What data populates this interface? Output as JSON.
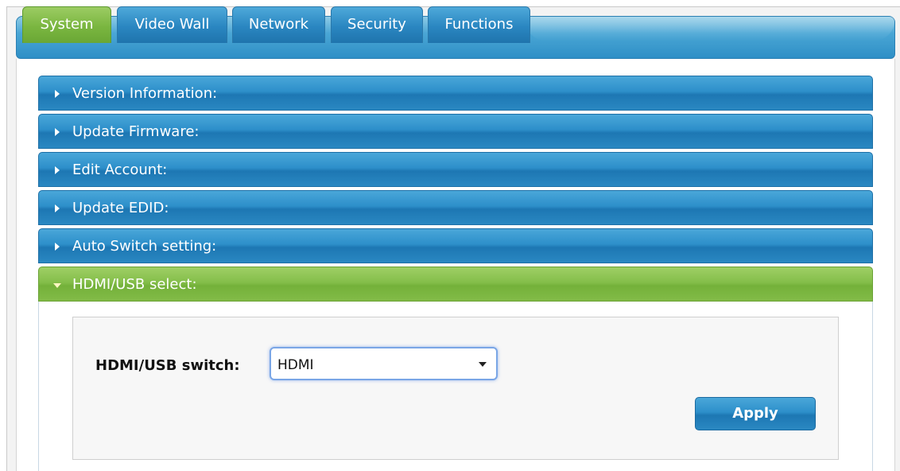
{
  "tabs": [
    {
      "label": "System",
      "active": true
    },
    {
      "label": "Video Wall",
      "active": false
    },
    {
      "label": "Network",
      "active": false
    },
    {
      "label": "Security",
      "active": false
    },
    {
      "label": "Functions",
      "active": false
    }
  ],
  "sections": [
    {
      "label": "Version Information:",
      "expanded": false
    },
    {
      "label": "Update Firmware:",
      "expanded": false
    },
    {
      "label": "Edit Account:",
      "expanded": false
    },
    {
      "label": "Update EDID:",
      "expanded": false
    },
    {
      "label": "Auto Switch setting:",
      "expanded": false
    },
    {
      "label": "HDMI/USB select:",
      "expanded": true
    }
  ],
  "hdmi_usb": {
    "switch_label": "HDMI/USB switch:",
    "selected_value": "HDMI",
    "apply_label": "Apply"
  },
  "colors": {
    "tab_active": "#7ab640",
    "tab_inactive": "#2a86c1",
    "section_header": "#2d8fca",
    "section_open": "#84be4a"
  }
}
